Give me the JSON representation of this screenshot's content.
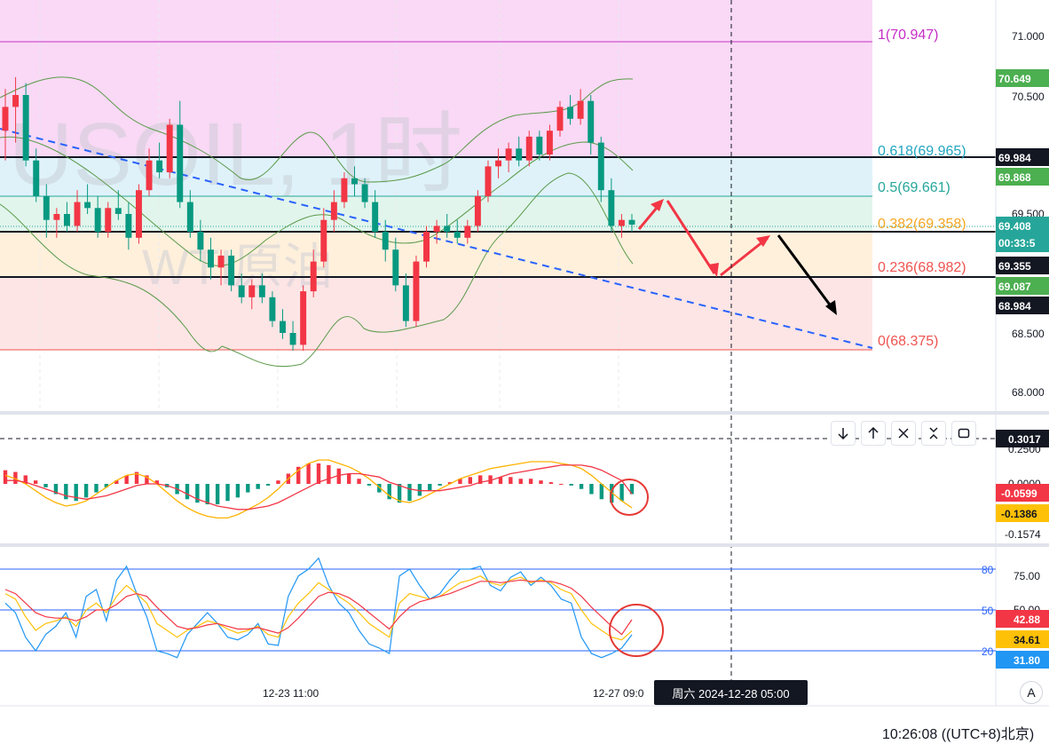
{
  "watermark": {
    "symbol": "USOIL, 1时",
    "name": "WTI原油"
  },
  "fib_labels": [
    {
      "level": "1",
      "value": "1(70.947)",
      "color": "#c62fc6"
    },
    {
      "level": "0.618",
      "value": "0.618(69.965)",
      "color": "#22a6c0"
    },
    {
      "level": "0.5",
      "value": "0.5(69.661)",
      "color": "#26a69a"
    },
    {
      "level": "0.382",
      "value": "0.382(69.358)",
      "color": "#f5a623"
    },
    {
      "level": "0.236",
      "value": "0.236(68.982)",
      "color": "#ef5350"
    },
    {
      "level": "0",
      "value": "0(68.375)",
      "color": "#ef5350"
    }
  ],
  "price_axis": {
    "ticks": [
      "71.000",
      "70.500",
      "69.500",
      "68.500",
      "68.000"
    ],
    "tags": [
      {
        "value": "70.649",
        "bg": "#4caf50"
      },
      {
        "value": "69.984",
        "bg": "#131722"
      },
      {
        "value": "69.868",
        "bg": "#4caf50"
      },
      {
        "value": "69.408",
        "bg": "#26a69a"
      },
      {
        "value": "00:33:5",
        "bg": "#26a69a"
      },
      {
        "value": "69.355",
        "bg": "#131722"
      },
      {
        "value": "69.087",
        "bg": "#4caf50"
      },
      {
        "value": "68.984",
        "bg": "#131722"
      }
    ]
  },
  "macd": {
    "axis_ticks": [
      "0.2500",
      "0.0000"
    ],
    "crosshair_value": "0.3017",
    "tags": [
      {
        "value": "-0.0599",
        "bg": "#f23645"
      },
      {
        "value": "-0.1386",
        "bg": "#ffc107"
      }
    ],
    "bottom_value": "-0.1574"
  },
  "kdj": {
    "axis_ticks": [
      "75.00",
      "50.00"
    ],
    "levels": [
      "80",
      "50",
      "20"
    ],
    "tags": [
      {
        "value": "42.88",
        "bg": "#f23645"
      },
      {
        "value": "34.61",
        "bg": "#ffc107"
      },
      {
        "value": "31.80",
        "bg": "#2196f3"
      }
    ]
  },
  "time_axis": {
    "labels": [
      "12-23 11:00",
      "12-27 09:0"
    ]
  },
  "crosshair_tooltip": "周六 2024-12-28  05:00",
  "scale_button": "A",
  "footer_clock": "10:26:08 ((UTC+8)北京)",
  "toolbar": {
    "icons": [
      "arrow-down-icon",
      "arrow-up-icon",
      "close-icon",
      "collapse-icon",
      "maximize-icon"
    ]
  },
  "chart_data": {
    "type": "candlestick",
    "symbol": "USOIL",
    "interval": "1时",
    "ylim": [
      67.9,
      71.15
    ],
    "fib_levels": [
      70.947,
      69.965,
      69.661,
      69.358,
      68.982,
      68.375
    ],
    "candles": [
      {
        "o": 70.2,
        "h": 70.55,
        "l": 69.95,
        "c": 70.4
      },
      {
        "o": 70.4,
        "h": 70.65,
        "l": 70.1,
        "c": 70.5
      },
      {
        "o": 70.5,
        "h": 70.6,
        "l": 69.9,
        "c": 69.95
      },
      {
        "o": 69.95,
        "h": 70.05,
        "l": 69.6,
        "c": 69.65
      },
      {
        "o": 69.65,
        "h": 69.75,
        "l": 69.3,
        "c": 69.45
      },
      {
        "o": 69.45,
        "h": 69.55,
        "l": 69.3,
        "c": 69.5
      },
      {
        "o": 69.5,
        "h": 69.6,
        "l": 69.35,
        "c": 69.4
      },
      {
        "o": 69.4,
        "h": 69.7,
        "l": 69.35,
        "c": 69.6
      },
      {
        "o": 69.6,
        "h": 69.75,
        "l": 69.5,
        "c": 69.55
      },
      {
        "o": 69.55,
        "h": 69.65,
        "l": 69.3,
        "c": 69.35
      },
      {
        "o": 69.35,
        "h": 69.6,
        "l": 69.3,
        "c": 69.55
      },
      {
        "o": 69.55,
        "h": 69.7,
        "l": 69.45,
        "c": 69.5
      },
      {
        "o": 69.5,
        "h": 69.6,
        "l": 69.2,
        "c": 69.3
      },
      {
        "o": 69.3,
        "h": 69.75,
        "l": 69.25,
        "c": 69.7
      },
      {
        "o": 69.7,
        "h": 70.05,
        "l": 69.65,
        "c": 69.95
      },
      {
        "o": 69.95,
        "h": 70.1,
        "l": 69.8,
        "c": 69.85
      },
      {
        "o": 69.85,
        "h": 70.3,
        "l": 69.8,
        "c": 70.25
      },
      {
        "o": 70.25,
        "h": 70.45,
        "l": 69.55,
        "c": 69.6
      },
      {
        "o": 69.6,
        "h": 69.7,
        "l": 69.3,
        "c": 69.35
      },
      {
        "o": 69.35,
        "h": 69.45,
        "l": 69.1,
        "c": 69.2
      },
      {
        "o": 69.2,
        "h": 69.3,
        "l": 68.95,
        "c": 69.05
      },
      {
        "o": 69.05,
        "h": 69.2,
        "l": 68.9,
        "c": 69.15
      },
      {
        "o": 69.15,
        "h": 69.2,
        "l": 68.85,
        "c": 68.9
      },
      {
        "o": 68.9,
        "h": 69.0,
        "l": 68.75,
        "c": 68.8
      },
      {
        "o": 68.8,
        "h": 68.95,
        "l": 68.7,
        "c": 68.9
      },
      {
        "o": 68.9,
        "h": 69.0,
        "l": 68.75,
        "c": 68.8
      },
      {
        "o": 68.8,
        "h": 68.85,
        "l": 68.55,
        "c": 68.6
      },
      {
        "o": 68.6,
        "h": 68.7,
        "l": 68.45,
        "c": 68.5
      },
      {
        "o": 68.5,
        "h": 68.6,
        "l": 68.35,
        "c": 68.4
      },
      {
        "o": 68.4,
        "h": 68.9,
        "l": 68.35,
        "c": 68.85
      },
      {
        "o": 68.85,
        "h": 69.2,
        "l": 68.8,
        "c": 69.1
      },
      {
        "o": 69.1,
        "h": 69.55,
        "l": 69.05,
        "c": 69.45
      },
      {
        "o": 69.45,
        "h": 69.7,
        "l": 69.35,
        "c": 69.6
      },
      {
        "o": 69.6,
        "h": 69.85,
        "l": 69.55,
        "c": 69.8
      },
      {
        "o": 69.8,
        "h": 69.9,
        "l": 69.65,
        "c": 69.75
      },
      {
        "o": 69.75,
        "h": 69.8,
        "l": 69.55,
        "c": 69.6
      },
      {
        "o": 69.6,
        "h": 69.7,
        "l": 69.3,
        "c": 69.35
      },
      {
        "o": 69.35,
        "h": 69.45,
        "l": 69.1,
        "c": 69.2
      },
      {
        "o": 69.2,
        "h": 69.3,
        "l": 68.85,
        "c": 68.9
      },
      {
        "o": 68.9,
        "h": 69.0,
        "l": 68.55,
        "c": 68.6
      },
      {
        "o": 68.6,
        "h": 69.15,
        "l": 68.55,
        "c": 69.1
      },
      {
        "o": 69.1,
        "h": 69.4,
        "l": 69.05,
        "c": 69.35
      },
      {
        "o": 69.35,
        "h": 69.45,
        "l": 69.25,
        "c": 69.4
      },
      {
        "o": 69.4,
        "h": 69.5,
        "l": 69.3,
        "c": 69.35
      },
      {
        "o": 69.35,
        "h": 69.45,
        "l": 69.25,
        "c": 69.3
      },
      {
        "o": 69.3,
        "h": 69.45,
        "l": 69.25,
        "c": 69.4
      },
      {
        "o": 69.4,
        "h": 69.7,
        "l": 69.35,
        "c": 69.65
      },
      {
        "o": 69.65,
        "h": 69.95,
        "l": 69.6,
        "c": 69.9
      },
      {
        "o": 69.9,
        "h": 70.05,
        "l": 69.8,
        "c": 69.95
      },
      {
        "o": 69.95,
        "h": 70.1,
        "l": 69.85,
        "c": 70.05
      },
      {
        "o": 70.05,
        "h": 70.15,
        "l": 69.9,
        "c": 69.95
      },
      {
        "o": 69.95,
        "h": 70.2,
        "l": 69.9,
        "c": 70.15
      },
      {
        "o": 70.15,
        "h": 70.2,
        "l": 69.95,
        "c": 70.0
      },
      {
        "o": 70.0,
        "h": 70.25,
        "l": 69.95,
        "c": 70.2
      },
      {
        "o": 70.2,
        "h": 70.45,
        "l": 70.15,
        "c": 70.4
      },
      {
        "o": 70.4,
        "h": 70.5,
        "l": 70.25,
        "c": 70.3
      },
      {
        "o": 70.3,
        "h": 70.55,
        "l": 70.25,
        "c": 70.45
      },
      {
        "o": 70.45,
        "h": 70.5,
        "l": 70.0,
        "c": 70.1
      },
      {
        "o": 70.1,
        "h": 70.15,
        "l": 69.6,
        "c": 69.7
      },
      {
        "o": 69.7,
        "h": 69.8,
        "l": 69.35,
        "c": 69.4
      },
      {
        "o": 69.4,
        "h": 69.5,
        "l": 69.3,
        "c": 69.45
      },
      {
        "o": 69.45,
        "h": 69.5,
        "l": 69.35,
        "c": 69.41
      }
    ],
    "macd": {
      "histogram": [
        0.08,
        0.07,
        0.05,
        0.02,
        -0.02,
        -0.06,
        -0.09,
        -0.1,
        -0.08,
        -0.05,
        -0.02,
        0.02,
        0.05,
        0.07,
        0.05,
        0.02,
        -0.02,
        -0.06,
        -0.09,
        -0.11,
        -0.12,
        -0.12,
        -0.1,
        -0.08,
        -0.05,
        -0.03,
        -0.01,
        0.02,
        0.06,
        0.1,
        0.12,
        0.12,
        0.11,
        0.09,
        0.06,
        0.03,
        -0.01,
        -0.05,
        -0.09,
        -0.11,
        -0.1,
        -0.07,
        -0.04,
        -0.01,
        0.01,
        0.03,
        0.04,
        0.05,
        0.05,
        0.04,
        0.04,
        0.03,
        0.03,
        0.02,
        0.01,
        0.0,
        -0.01,
        -0.03,
        -0.06,
        -0.09,
        -0.11,
        -0.1,
        -0.06
      ],
      "dif": [
        0.05,
        0.03,
        0.0,
        -0.04,
        -0.08,
        -0.11,
        -0.13,
        -0.12,
        -0.1,
        -0.06,
        -0.02,
        0.02,
        0.05,
        0.06,
        0.04,
        0.0,
        -0.05,
        -0.1,
        -0.14,
        -0.17,
        -0.19,
        -0.2,
        -0.2,
        -0.18,
        -0.15,
        -0.12,
        -0.08,
        -0.03,
        0.03,
        0.08,
        0.12,
        0.14,
        0.14,
        0.12,
        0.1,
        0.07,
        0.03,
        -0.02,
        -0.07,
        -0.1,
        -0.11,
        -0.09,
        -0.06,
        -0.03,
        0.0,
        0.03,
        0.05,
        0.07,
        0.09,
        0.1,
        0.11,
        0.12,
        0.13,
        0.13,
        0.13,
        0.12,
        0.11,
        0.09,
        0.05,
        0.0,
        -0.05,
        -0.1,
        -0.14
      ],
      "dea": [
        0.02,
        0.02,
        0.01,
        -0.01,
        -0.03,
        -0.05,
        -0.07,
        -0.08,
        -0.09,
        -0.08,
        -0.07,
        -0.05,
        -0.03,
        -0.01,
        0.0,
        0.0,
        -0.01,
        -0.03,
        -0.06,
        -0.09,
        -0.11,
        -0.13,
        -0.14,
        -0.15,
        -0.15,
        -0.14,
        -0.13,
        -0.11,
        -0.08,
        -0.05,
        -0.02,
        0.01,
        0.03,
        0.05,
        0.06,
        0.06,
        0.05,
        0.04,
        0.01,
        -0.01,
        -0.03,
        -0.04,
        -0.04,
        -0.04,
        -0.03,
        -0.02,
        -0.01,
        0.01,
        0.02,
        0.04,
        0.06,
        0.07,
        0.08,
        0.09,
        0.1,
        0.11,
        0.11,
        0.11,
        0.1,
        0.08,
        0.05,
        0.02,
        -0.06
      ]
    },
    "kdj": {
      "k": [
        62,
        58,
        45,
        35,
        40,
        42,
        45,
        38,
        50,
        55,
        48,
        60,
        68,
        62,
        55,
        40,
        35,
        30,
        35,
        38,
        42,
        40,
        36,
        33,
        35,
        38,
        32,
        30,
        45,
        55,
        62,
        70,
        65,
        60,
        55,
        48,
        40,
        35,
        30,
        55,
        62,
        60,
        58,
        60,
        65,
        70,
        72,
        75,
        70,
        68,
        72,
        74,
        70,
        72,
        70,
        65,
        62,
        50,
        40,
        35,
        30,
        28,
        34.61
      ],
      "d": [
        65,
        62,
        55,
        48,
        45,
        44,
        44,
        42,
        45,
        50,
        50,
        54,
        60,
        62,
        60,
        52,
        45,
        38,
        36,
        37,
        39,
        40,
        38,
        36,
        36,
        37,
        35,
        33,
        37,
        44,
        52,
        60,
        63,
        62,
        59,
        54,
        48,
        42,
        36,
        45,
        52,
        56,
        58,
        60,
        62,
        65,
        68,
        71,
        71,
        70,
        71,
        72,
        71,
        71,
        71,
        69,
        66,
        60,
        52,
        45,
        38,
        32,
        42.88
      ],
      "j": [
        55,
        48,
        30,
        20,
        32,
        38,
        48,
        30,
        60,
        65,
        42,
        72,
        82,
        62,
        45,
        20,
        18,
        15,
        32,
        40,
        48,
        40,
        30,
        28,
        32,
        40,
        25,
        24,
        60,
        75,
        80,
        88,
        68,
        55,
        48,
        35,
        25,
        22,
        18,
        75,
        80,
        68,
        58,
        62,
        72,
        80,
        80,
        82,
        68,
        64,
        74,
        78,
        68,
        74,
        68,
        58,
        55,
        30,
        18,
        15,
        18,
        22,
        31.8
      ]
    }
  }
}
